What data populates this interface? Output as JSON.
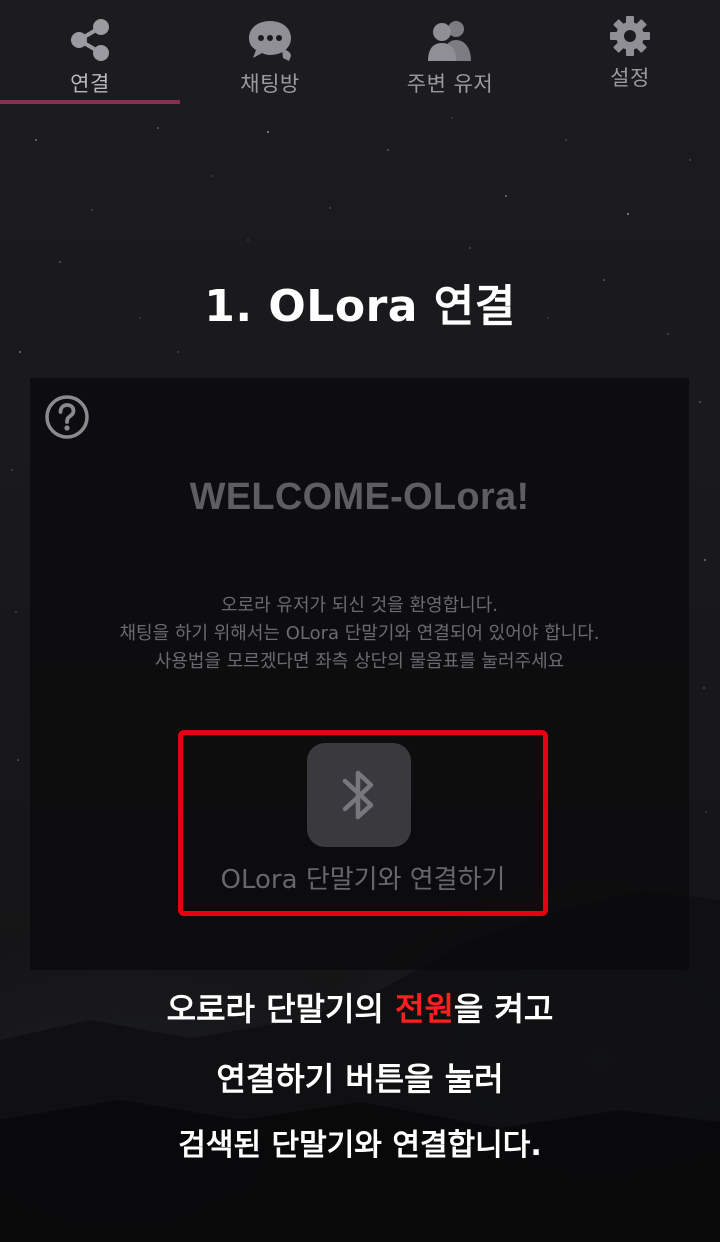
{
  "tabs": [
    {
      "label": "연결",
      "icon": "share-icon",
      "active": true
    },
    {
      "label": "채팅방",
      "icon": "chat-icon",
      "active": false
    },
    {
      "label": "주변 유저",
      "icon": "users-icon",
      "active": false
    },
    {
      "label": "설정",
      "icon": "gear-icon",
      "active": false
    }
  ],
  "step_title": "1. OLora 연결",
  "card": {
    "help_icon": "help-icon",
    "welcome_title": "WELCOME-OLora!",
    "description": [
      "오로라 유저가 되신 것을 환영합니다.",
      "채팅을 하기 위해서는 OLora 단말기와 연결되어 있어야 합니다.",
      "사용법을 모르겠다면 좌측 상단의 물음표를 눌러주세요"
    ],
    "connect_icon": "bluetooth-icon",
    "connect_label": "OLora 단말기와 연결하기"
  },
  "instructions": {
    "line1_before": "오로라 단말기의 ",
    "line1_highlight": "전원",
    "line1_after": "을 켜고",
    "line2": "연결하기 버튼을 눌러",
    "line3": "검색된 단말기와 연결합니다."
  },
  "colors": {
    "accent_indicator": "#8a2f52",
    "highlight_box": "#e60012",
    "highlight_text": "#ff1f1f"
  }
}
